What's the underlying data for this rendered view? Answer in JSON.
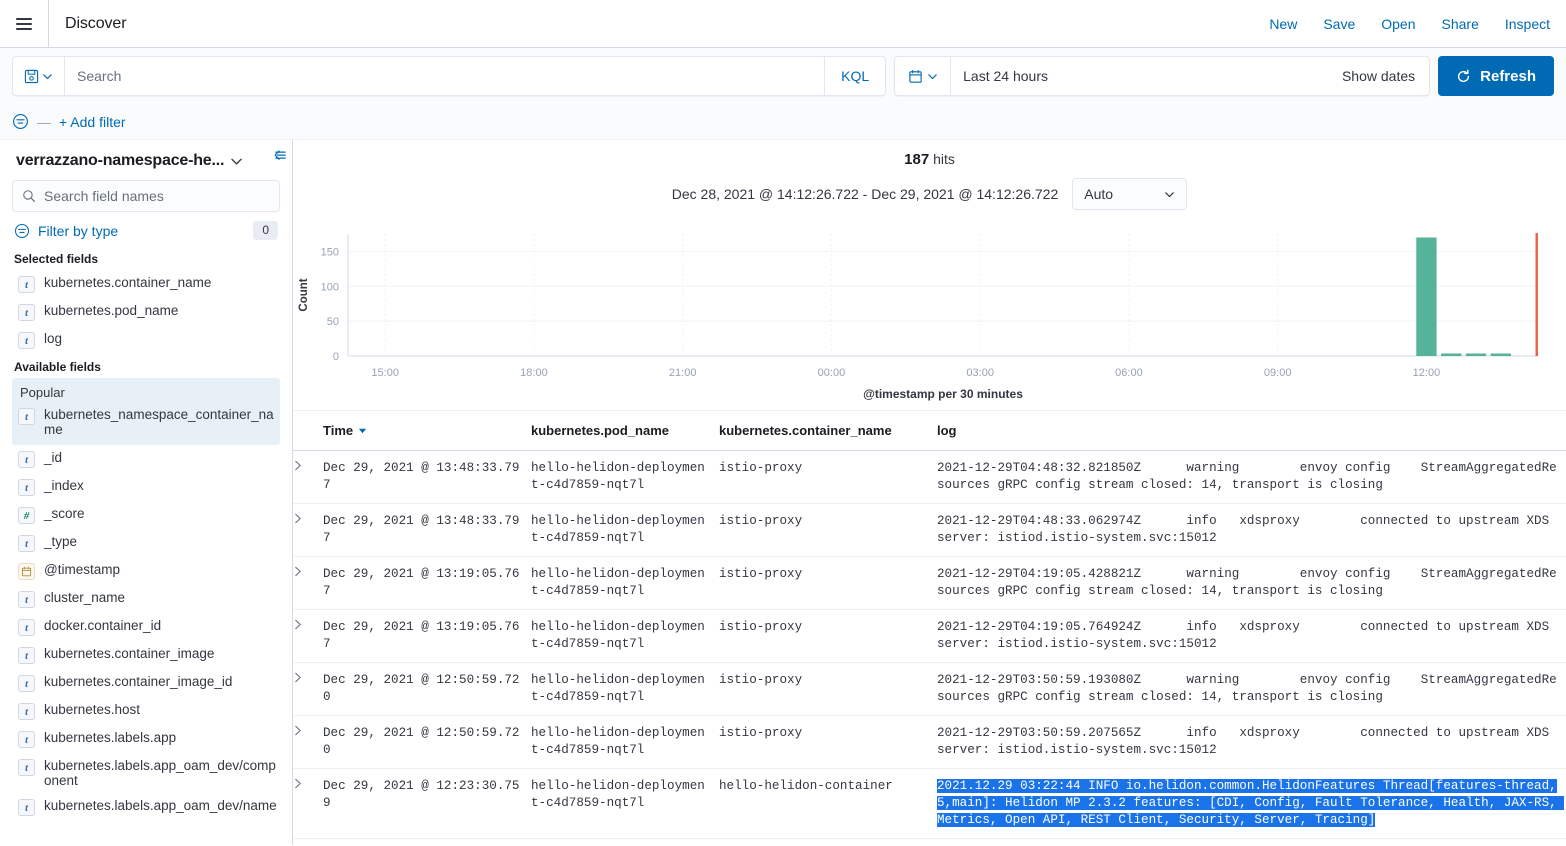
{
  "topbar": {
    "menu_icon": "hamburger-icon",
    "app_title": "Discover",
    "actions": [
      {
        "label": "New"
      },
      {
        "label": "Save"
      },
      {
        "label": "Open"
      },
      {
        "label": "Share"
      },
      {
        "label": "Inspect"
      }
    ]
  },
  "querybar": {
    "saved_query_icon": "save-disk-icon",
    "search_placeholder": "Search",
    "search_value": "",
    "language_badge": "KQL",
    "calendar_icon": "calendar-icon",
    "date_range": "Last 24 hours",
    "show_dates_label": "Show dates",
    "refresh_label": "Refresh",
    "refresh_icon": "refresh-icon",
    "refresh_color": "#006bb4"
  },
  "filterbar": {
    "filter_icon": "filter-options-icon",
    "separator": "—",
    "add_filter_label": "+ Add filter"
  },
  "sidebar": {
    "index_pattern": "verrazzano-namespace-he...",
    "index_chevron_icon": "chevron-down-icon",
    "collapse_icon": "collapse-sidebar-icon",
    "search_icon": "search-icon",
    "search_placeholder": "Search field names",
    "search_value": "",
    "filter_by_type_icon": "filter-icon",
    "filter_by_type_label": "Filter by type",
    "filter_by_type_count": "0",
    "selected_fields_heading": "Selected fields",
    "selected_fields": [
      {
        "type": "t",
        "name": "kubernetes.container_name"
      },
      {
        "type": "t",
        "name": "kubernetes.pod_name"
      },
      {
        "type": "t",
        "name": "log"
      }
    ],
    "available_fields_heading": "Available fields",
    "popular_label": "Popular",
    "popular_fields": [
      {
        "type": "t",
        "name": "kubernetes_namespace_container_name"
      }
    ],
    "available_fields": [
      {
        "type": "t",
        "name": "_id"
      },
      {
        "type": "t",
        "name": "_index"
      },
      {
        "type": "#",
        "name": "_score"
      },
      {
        "type": "t",
        "name": "_type"
      },
      {
        "type": "date",
        "name": "@timestamp"
      },
      {
        "type": "t",
        "name": "cluster_name"
      },
      {
        "type": "t",
        "name": "docker.container_id"
      },
      {
        "type": "t",
        "name": "kubernetes.container_image"
      },
      {
        "type": "t",
        "name": "kubernetes.container_image_id"
      },
      {
        "type": "t",
        "name": "kubernetes.host"
      },
      {
        "type": "t",
        "name": "kubernetes.labels.app"
      },
      {
        "type": "t",
        "name": "kubernetes.labels.app_oam_dev/component"
      },
      {
        "type": "t",
        "name": "kubernetes.labels.app_oam_dev/name"
      }
    ]
  },
  "main": {
    "hits_count": "187",
    "hits_label": "hits",
    "time_range": "Dec 28, 2021 @ 14:12:26.722 - Dec 29, 2021 @ 14:12:26.722",
    "interval_value": "Auto",
    "interval_chevron_icon": "chevron-down-icon"
  },
  "chart_data": {
    "type": "bar",
    "title": "",
    "xlabel": "@timestamp per 30 minutes",
    "ylabel": "Count",
    "ylim": [
      0,
      175
    ],
    "yticks": [
      0,
      50,
      100,
      150
    ],
    "xticks": [
      "15:00",
      "18:00",
      "21:00",
      "00:00",
      "03:00",
      "06:00",
      "09:00",
      "12:00"
    ],
    "grid": true,
    "bar_color": "#54b399",
    "marker_color": "#e7664c",
    "marker_label": "current-time-marker",
    "categories": [
      "14:30",
      "15:00",
      "15:30",
      "16:00",
      "16:30",
      "17:00",
      "17:30",
      "18:00",
      "18:30",
      "19:00",
      "19:30",
      "20:00",
      "20:30",
      "21:00",
      "21:30",
      "22:00",
      "22:30",
      "23:00",
      "23:30",
      "00:00",
      "00:30",
      "01:00",
      "01:30",
      "02:00",
      "02:30",
      "03:00",
      "03:30",
      "04:00",
      "04:30",
      "05:00",
      "05:30",
      "06:00",
      "06:30",
      "07:00",
      "07:30",
      "08:00",
      "08:30",
      "09:00",
      "09:30",
      "10:00",
      "10:30",
      "11:00",
      "11:30",
      "12:00",
      "12:30",
      "13:00",
      "13:30",
      "14:00"
    ],
    "values": [
      0,
      0,
      0,
      0,
      0,
      0,
      0,
      0,
      0,
      0,
      0,
      0,
      0,
      0,
      0,
      0,
      0,
      0,
      0,
      0,
      0,
      0,
      0,
      0,
      0,
      0,
      0,
      0,
      0,
      0,
      0,
      0,
      0,
      0,
      0,
      0,
      0,
      0,
      0,
      0,
      0,
      0,
      0,
      170,
      3,
      3,
      3,
      0
    ]
  },
  "table": {
    "columns": [
      {
        "key": "expand",
        "label": ""
      },
      {
        "key": "time",
        "label": "Time",
        "sort_icon": "sort-desc-icon"
      },
      {
        "key": "pod",
        "label": "kubernetes.pod_name"
      },
      {
        "key": "container",
        "label": "kubernetes.container_name"
      },
      {
        "key": "log",
        "label": "log"
      }
    ],
    "expand_icon": "chevron-right-icon",
    "rows": [
      {
        "time": "Dec 29, 2021 @ 13:48:33.797",
        "pod": "hello-helidon-deployment-c4d7859-nqt7l",
        "container": "istio-proxy",
        "log": "2021-12-29T04:48:32.821850Z\t warning\tenvoy config\tStreamAggregatedResources gRPC config stream closed: 14, transport is closing",
        "selected": false
      },
      {
        "time": "Dec 29, 2021 @ 13:48:33.797",
        "pod": "hello-helidon-deployment-c4d7859-nqt7l",
        "container": "istio-proxy",
        "log": "2021-12-29T04:48:33.062974Z\t info\txdsproxy\tconnected to upstream XDS server: istiod.istio-system.svc:15012",
        "selected": false
      },
      {
        "time": "Dec 29, 2021 @ 13:19:05.767",
        "pod": "hello-helidon-deployment-c4d7859-nqt7l",
        "container": "istio-proxy",
        "log": "2021-12-29T04:19:05.428821Z\t warning\tenvoy config\tStreamAggregatedResources gRPC config stream closed: 14, transport is closing",
        "selected": false
      },
      {
        "time": "Dec 29, 2021 @ 13:19:05.767",
        "pod": "hello-helidon-deployment-c4d7859-nqt7l",
        "container": "istio-proxy",
        "log": "2021-12-29T04:19:05.764924Z\t info\txdsproxy\tconnected to upstream XDS server: istiod.istio-system.svc:15012",
        "selected": false
      },
      {
        "time": "Dec 29, 2021 @ 12:50:59.720",
        "pod": "hello-helidon-deployment-c4d7859-nqt7l",
        "container": "istio-proxy",
        "log": "2021-12-29T03:50:59.193080Z\t warning\tenvoy config\tStreamAggregatedResources gRPC config stream closed: 14, transport is closing",
        "selected": false
      },
      {
        "time": "Dec 29, 2021 @ 12:50:59.720",
        "pod": "hello-helidon-deployment-c4d7859-nqt7l",
        "container": "istio-proxy",
        "log": "2021-12-29T03:50:59.207565Z\t info\txdsproxy\tconnected to upstream XDS server: istiod.istio-system.svc:15012",
        "selected": false
      },
      {
        "time": "Dec 29, 2021 @ 12:23:30.759",
        "pod": "hello-helidon-deployment-c4d7859-nqt7l",
        "container": "hello-helidon-container",
        "log": "2021.12.29 03:22:44 INFO io.helidon.common.HelidonFeatures Thread[features-thread,5,main]: Helidon MP 2.3.2 features: [CDI, Config, Fault Tolerance, Health, JAX-RS, Metrics, Open API, REST Client, Security, Server, Tracing]",
        "selected": true
      }
    ]
  }
}
